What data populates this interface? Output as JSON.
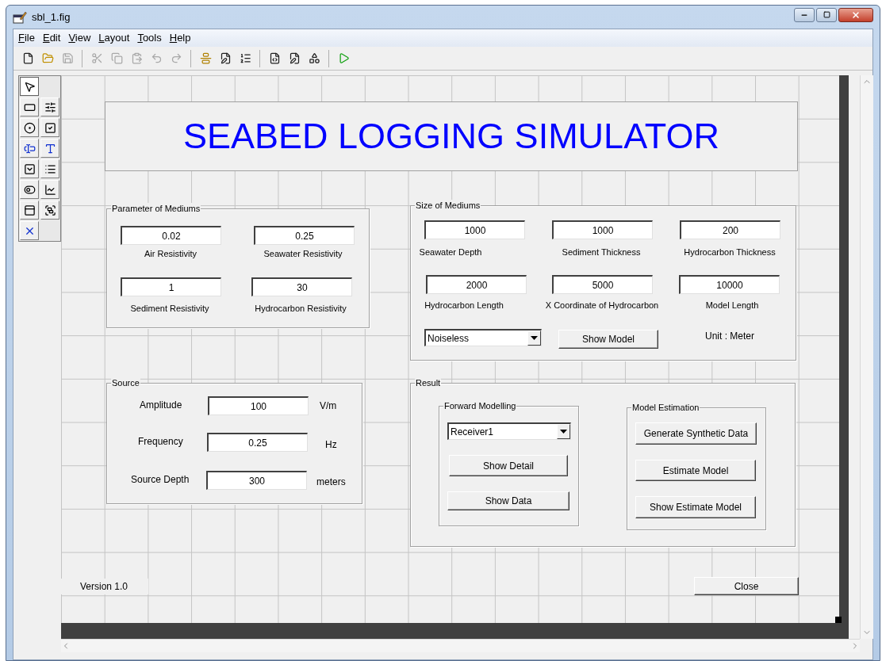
{
  "window": {
    "title": "sbl_1.fig"
  },
  "menu": [
    {
      "label": "File"
    },
    {
      "label": "Edit"
    },
    {
      "label": "View"
    },
    {
      "label": "Layout"
    },
    {
      "label": "Tools"
    },
    {
      "label": "Help"
    }
  ],
  "toolbar": [
    {
      "kind": "new",
      "disabled": false
    },
    {
      "kind": "open",
      "disabled": false
    },
    {
      "kind": "save",
      "disabled": true
    },
    {
      "kind": "cut",
      "disabled": true
    },
    {
      "kind": "copy",
      "disabled": true
    },
    {
      "kind": "paste",
      "disabled": true
    },
    {
      "kind": "undo",
      "disabled": true
    },
    {
      "kind": "redo",
      "disabled": true
    },
    {
      "kind": "align",
      "disabled": false
    },
    {
      "kind": "menu_editor",
      "disabled": false
    },
    {
      "kind": "tab_order",
      "disabled": false
    },
    {
      "kind": "editor",
      "disabled": false
    },
    {
      "kind": "inspector",
      "disabled": false
    },
    {
      "kind": "browser",
      "disabled": false
    },
    {
      "kind": "run",
      "disabled": false
    }
  ],
  "palette": [
    {
      "kind": "pointer",
      "selected": true
    },
    {
      "kind": "push",
      "selected": false
    },
    {
      "kind": "slider",
      "selected": false
    },
    {
      "kind": "radio",
      "selected": false
    },
    {
      "kind": "check",
      "selected": false
    },
    {
      "kind": "edit",
      "selected": false
    },
    {
      "kind": "text",
      "selected": false
    },
    {
      "kind": "popup",
      "selected": false
    },
    {
      "kind": "list",
      "selected": false
    },
    {
      "kind": "toggle",
      "selected": false
    },
    {
      "kind": "axes",
      "selected": false
    },
    {
      "kind": "panel",
      "selected": false
    },
    {
      "kind": "group",
      "selected": false
    },
    {
      "kind": "activex",
      "selected": false
    }
  ],
  "banner": {
    "title": "SEABED LOGGING SIMULATOR"
  },
  "parameters": {
    "title": "Parameter of Mediums",
    "fields": [
      {
        "value": "0.02",
        "label": "Air Resistivity"
      },
      {
        "value": "0.25",
        "label": "Seawater Resistivity"
      },
      {
        "value": "1",
        "label": "Sediment Resistivity"
      },
      {
        "value": "30",
        "label": "Hydrocarbon Resistivity"
      }
    ]
  },
  "sizes": {
    "title": "Size of Mediums",
    "fields": [
      {
        "value": "1000",
        "label": "Seawater Depth"
      },
      {
        "value": "1000",
        "label": "Sediment Thickness"
      },
      {
        "value": "200",
        "label": "Hydrocarbon Thickness"
      },
      {
        "value": "2000",
        "label": "Hydrocarbon Length"
      },
      {
        "value": "5000",
        "label": "X Coordinate of Hydrocarbon"
      },
      {
        "value": "10000",
        "label": "Model Length"
      }
    ],
    "noise_popup": "Noiseless",
    "button": "Show Model",
    "note": "Unit : Meter"
  },
  "source": {
    "title": "Source",
    "fields": [
      {
        "label": "Amplitude",
        "value": "100",
        "unit": "V/m"
      },
      {
        "label": "Frequency",
        "value": "0.25",
        "unit": "Hz"
      },
      {
        "label": "Source Depth",
        "value": "300",
        "unit": "meters"
      }
    ]
  },
  "result": {
    "title": "Result",
    "forward": {
      "title": "Forward Modelling",
      "popup": "Receiver1",
      "buttons": [
        "Show Detail",
        "Show Data"
      ]
    },
    "estimation": {
      "title": "Model Estimation",
      "buttons": [
        "Generate Synthetic Data",
        "Estimate Model",
        "Show Estimate Model"
      ]
    }
  },
  "version": "Version 1.0",
  "close_button": "Close"
}
